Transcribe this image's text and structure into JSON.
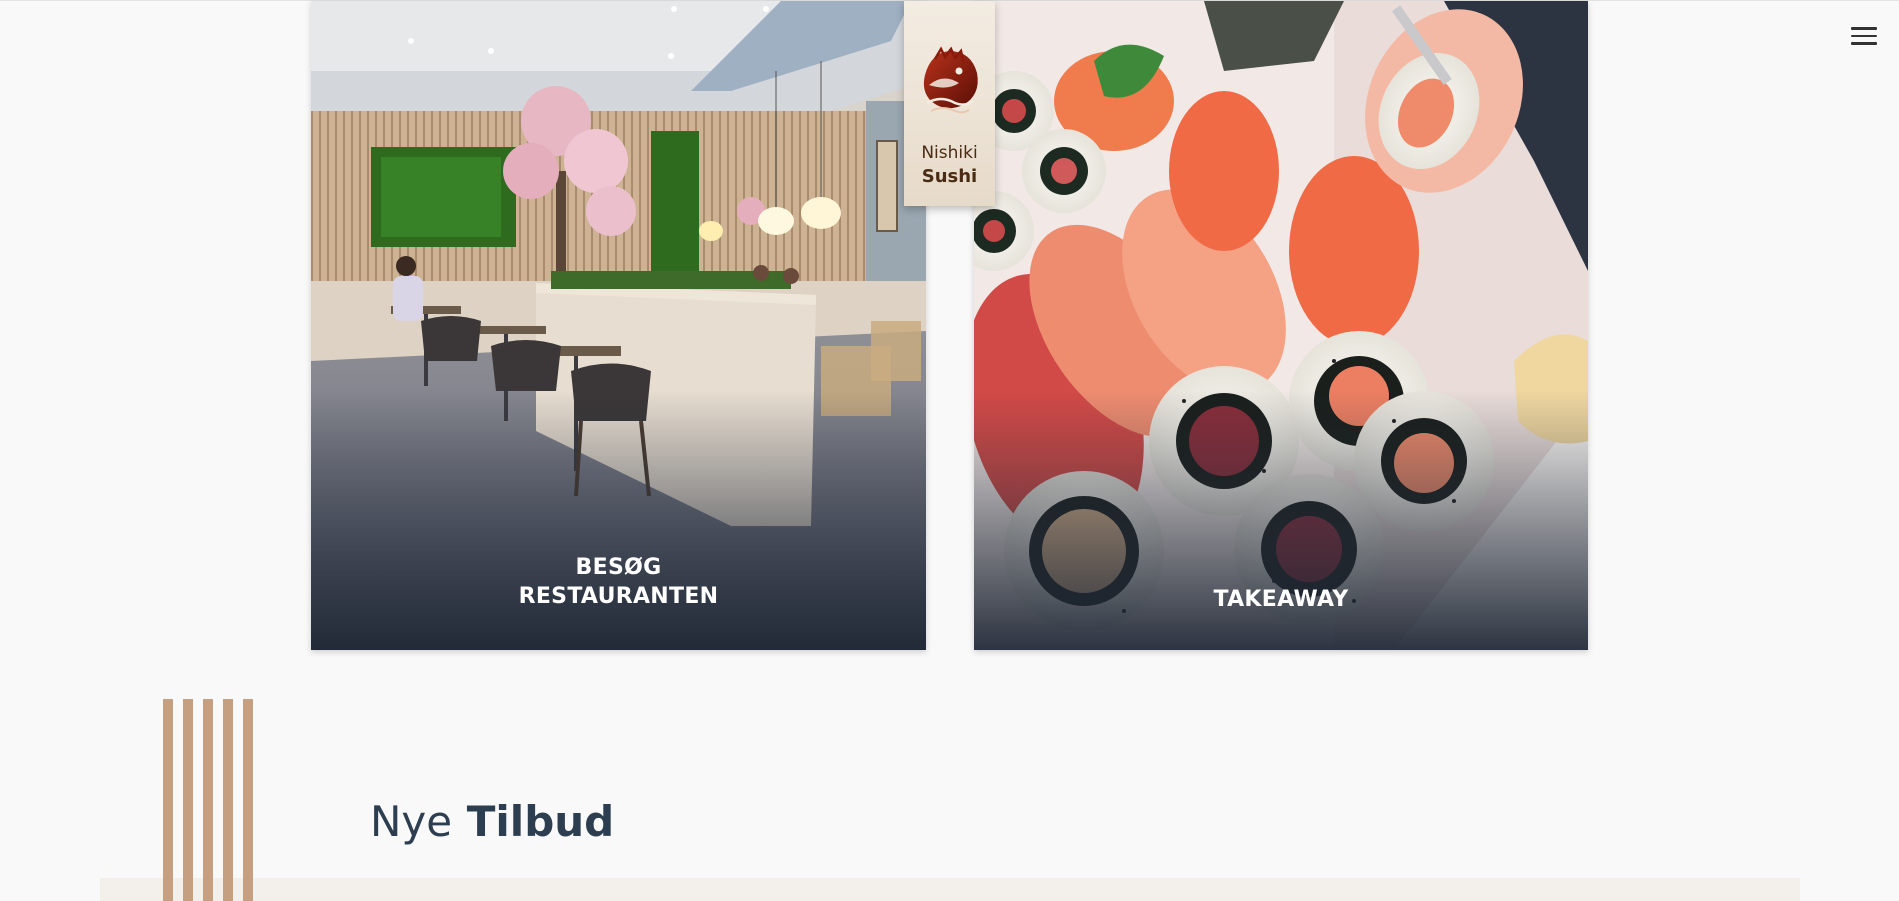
{
  "brand": {
    "name_line1": "Nishiki",
    "name_line2": "Sushi",
    "logo_icon": "koi-fish-logo"
  },
  "header": {
    "menu_icon": "hamburger-menu-icon"
  },
  "cards": [
    {
      "id": "restaurant",
      "label_line1": "BESØG",
      "label_line2": "RESTAURANTEN",
      "image": "restaurant-interior-photo"
    },
    {
      "id": "takeaway",
      "label_line1": "TAKEAWAY",
      "image": "sushi-takeaway-box-photo"
    }
  ],
  "offers": {
    "heading_light": "Nye",
    "heading_bold": "Tilbud"
  },
  "colors": {
    "background": "#f9f9f9",
    "accent": "#c59f80",
    "heading": "#2c3e50",
    "brand_text": "#4a2c14",
    "logo_red": "#8a1a0c",
    "overlay": "#1e2634"
  }
}
